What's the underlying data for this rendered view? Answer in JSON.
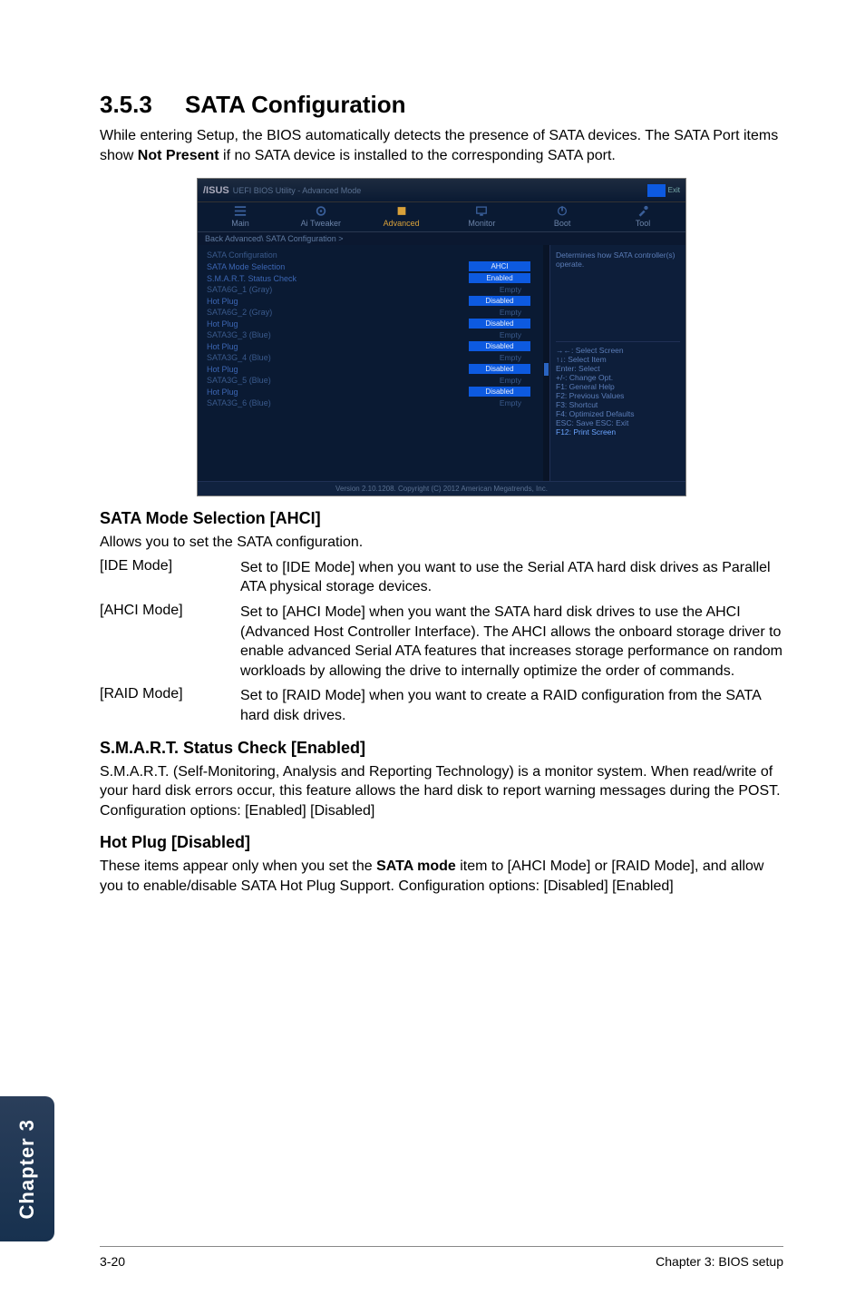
{
  "section": {
    "number": "3.5.3",
    "title": "SATA Configuration",
    "intro": "While entering Setup, the BIOS automatically detects the presence of SATA devices. The SATA Port items show Not Present if no SATA device is installed to the corresponding SATA port.",
    "intro_bold": "Not Present"
  },
  "bios": {
    "logo": "/ISUS",
    "header_suffix": "UEFI BIOS Utility - Advanced Mode",
    "header_exit": "Exit",
    "tabs": [
      {
        "label": "Main",
        "icon": "list"
      },
      {
        "label": "Ai Tweaker",
        "icon": "gear"
      },
      {
        "label": "Advanced",
        "icon": "chip"
      },
      {
        "label": "Monitor",
        "icon": "monitor"
      },
      {
        "label": "Boot",
        "icon": "power"
      },
      {
        "label": "Tool",
        "icon": "tools"
      }
    ],
    "breadcrumb": "Back   Advanced\\ SATA Configuration >",
    "help_top": "Determines how SATA controller(s) operate.",
    "help_nav": [
      "→←: Select Screen",
      "↑↓: Select Item",
      "Enter: Select",
      "+/-: Change Opt.",
      "F1: General Help",
      "F2: Previous Values",
      "F3: Shortcut",
      "F4: Optimized Defaults",
      "ESC: Save  ESC: Exit",
      "F12: Print Screen"
    ],
    "rows": [
      {
        "label": "SATA Configuration",
        "type": "head"
      },
      {
        "label": "SATA Mode Selection",
        "value": "AHCI",
        "btn": true
      },
      {
        "label": "S.M.A.R.T. Status Check",
        "value": "Enabled",
        "btn": true
      },
      {
        "label": "SATA6G_1 (Gray)",
        "value": "Empty",
        "txt": true
      },
      {
        "label": "Hot Plug",
        "value": "Disabled",
        "btn": true
      },
      {
        "label": "SATA6G_2 (Gray)",
        "value": "Empty",
        "txt": true
      },
      {
        "label": "Hot Plug",
        "value": "Disabled",
        "btn": true
      },
      {
        "label": "SATA3G_3 (Blue)",
        "value": "Empty",
        "txt": true
      },
      {
        "label": "Hot Plug",
        "value": "Disabled",
        "btn": true
      },
      {
        "label": "SATA3G_4 (Blue)",
        "value": "Empty",
        "txt": true
      },
      {
        "label": "Hot Plug",
        "value": "Disabled",
        "btn": true
      },
      {
        "label": "SATA3G_5 (Blue)",
        "value": "Empty",
        "txt": true
      },
      {
        "label": "Hot Plug",
        "value": "Disabled",
        "btn": true
      },
      {
        "label": "SATA3G_6 (Blue)",
        "value": "Empty",
        "txt": true
      }
    ],
    "footer": "Version 2.10.1208. Copyright (C) 2012 American Megatrends, Inc."
  },
  "sataMode": {
    "heading": "SATA Mode Selection [AHCI]",
    "intro": "Allows you to set the SATA configuration.",
    "options": [
      {
        "key": "[IDE Mode]",
        "val": "Set to [IDE Mode] when you want to use the Serial ATA hard disk drives as Parallel ATA physical storage devices."
      },
      {
        "key": "[AHCI Mode]",
        "val": "Set to [AHCI Mode] when you want the SATA hard disk drives to use the AHCI (Advanced Host Controller Interface). The AHCI allows the onboard storage driver to enable advanced Serial ATA features that increases storage performance on random workloads by allowing the drive to internally optimize the order of commands."
      },
      {
        "key": "[RAID Mode]",
        "val": "Set to [RAID Mode] when you want to create a RAID configuration from the SATA hard disk drives."
      }
    ]
  },
  "smart": {
    "heading": "S.M.A.R.T. Status Check [Enabled]",
    "body": "S.M.A.R.T. (Self-Monitoring, Analysis and Reporting Technology) is a monitor system. When read/write of your hard disk errors occur, this feature allows the hard disk to report warning messages during the POST. Configuration options: [Enabled] [Disabled]"
  },
  "hotplug": {
    "heading": "Hot Plug [Disabled]",
    "body_pre": "These items appear only when you set the ",
    "body_bold": "SATA mode",
    "body_post": " item to [AHCI Mode] or [RAID Mode], and allow you to enable/disable SATA Hot Plug Support. Configuration options: [Disabled] [Enabled]"
  },
  "sidetab": "Chapter 3",
  "footer": {
    "left": "3-20",
    "right": "Chapter 3: BIOS setup"
  }
}
